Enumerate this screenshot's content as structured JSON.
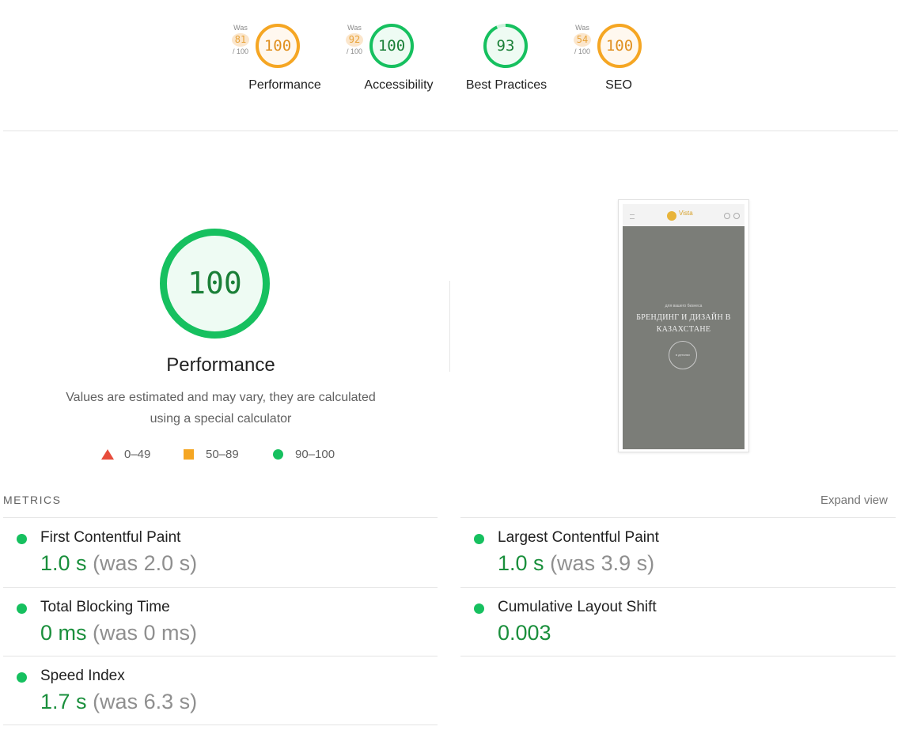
{
  "gauges": [
    {
      "label": "Performance",
      "score": "100",
      "prev_name": "Was",
      "prev_score": "81",
      "prev_denom": "/ 100",
      "color": "#f5a623",
      "track": "#fde9cc",
      "fill": "#fff8ef",
      "numcolor": "#e09020",
      "ring_fraction": 1.0
    },
    {
      "label": "Accessibility",
      "score": "100",
      "prev_name": "Was",
      "prev_score": "92",
      "prev_denom": "/ 100",
      "color": "#16c05f",
      "track": "#cdf2dc",
      "fill": "#eefbf3",
      "numcolor": "#1a7f37",
      "ring_fraction": 1.0
    },
    {
      "label": "Best Practices",
      "score": "93",
      "color": "#16c05f",
      "track": "#cdf2dc",
      "fill": "#eefbf3",
      "numcolor": "#1a7f37",
      "ring_fraction": 0.93
    },
    {
      "label": "SEO",
      "score": "100",
      "prev_name": "Was",
      "prev_score": "54",
      "prev_denom": "/ 100",
      "color": "#f5a623",
      "track": "#fde9cc",
      "fill": "#fff8ef",
      "numcolor": "#e09020",
      "ring_fraction": 1.0
    }
  ],
  "performance": {
    "score": "100",
    "title": "Performance",
    "description_line1": "Values are estimated and may vary, they are calculated",
    "description_line2": "using a special calculator",
    "legend": [
      {
        "shape": "triangle",
        "range": "0–49"
      },
      {
        "shape": "square",
        "range": "50–89"
      },
      {
        "shape": "circle",
        "range": "90–100"
      }
    ]
  },
  "thumbnail": {
    "logo_text": "Vista",
    "small_text": "для вашего бизнеса",
    "headline": "БРЕНДИНГ И ДИЗАЙН В КАЗАХСТАНЕ",
    "circle_text": "в деталях"
  },
  "metrics": {
    "section_label": "METRICS",
    "expand_label": "Expand view",
    "items": [
      {
        "name": "First Contentful Paint",
        "value": "1.0 s",
        "was": "(was 2.0 s)"
      },
      {
        "name": "Largest Contentful Paint",
        "value": "1.0 s",
        "was": "(was 3.9 s)"
      },
      {
        "name": "Total Blocking Time",
        "value": "0 ms",
        "was": "(was 0 ms)"
      },
      {
        "name": "Cumulative Layout Shift",
        "value": "0.003",
        "was": ""
      },
      {
        "name": "Speed Index",
        "value": "1.7 s",
        "was": "(was 6.3 s)"
      }
    ]
  },
  "colors": {
    "pass": "#16c05f",
    "average": "#f5a623",
    "fail": "#e74c3c"
  }
}
